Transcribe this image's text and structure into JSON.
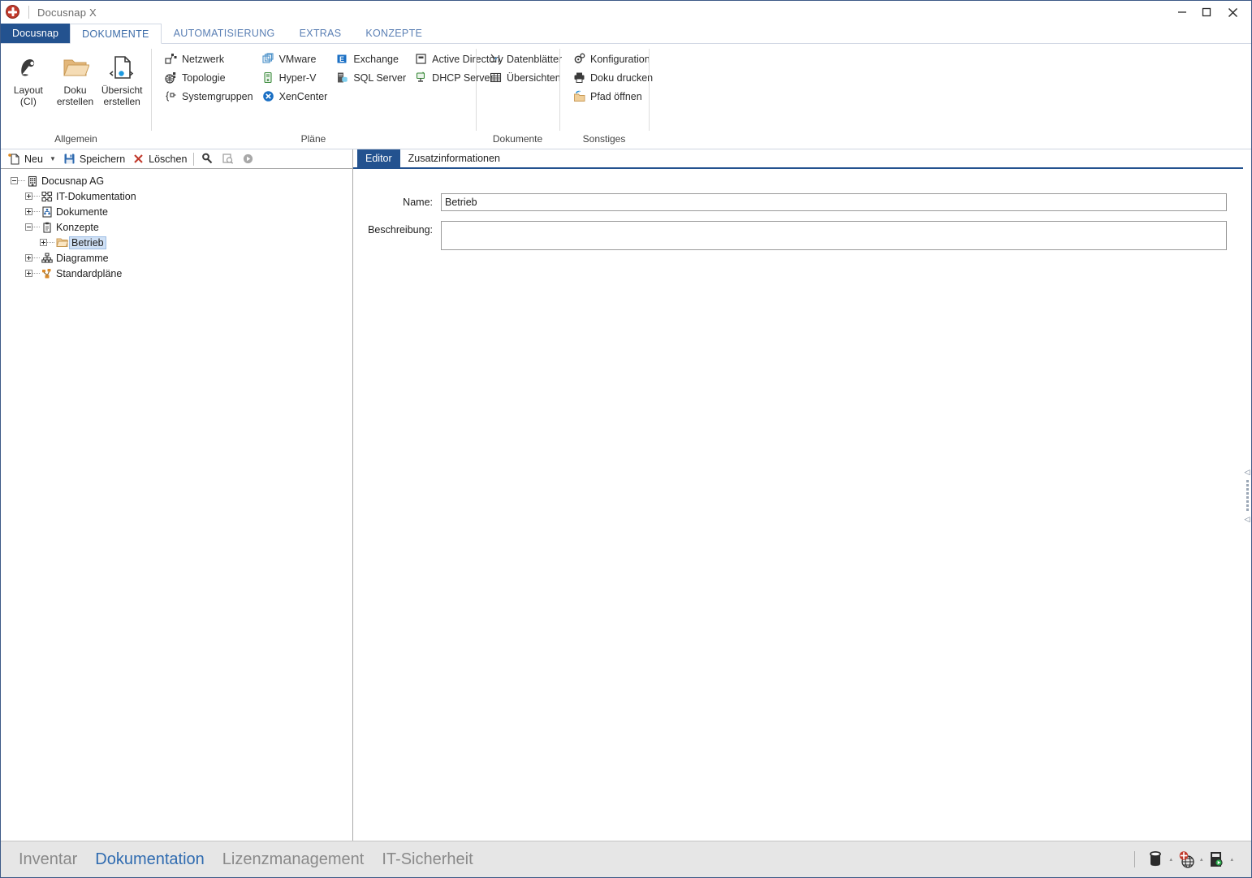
{
  "window": {
    "title": "Docusnap X",
    "logo_icon": "docusnap-logo-icon",
    "minimize_label": "–",
    "maximize_label": "□",
    "close_label": "✕"
  },
  "ribbon_tabs": [
    {
      "label": "Docusnap",
      "state": "brand"
    },
    {
      "label": "DOKUMENTE",
      "state": "active"
    },
    {
      "label": "AUTOMATISIERUNG",
      "state": "normal"
    },
    {
      "label": "EXTRAS",
      "state": "normal"
    },
    {
      "label": "KONZEPTE",
      "state": "normal"
    }
  ],
  "ribbon_groups": [
    {
      "name": "Allgemein",
      "label": "Allgemein",
      "big_buttons": [
        {
          "label_line1": "Layout",
          "label_line2": "(CI)",
          "icon": "layout-ci-icon"
        },
        {
          "label_line1": "Doku",
          "label_line2": "erstellen",
          "icon": "folder-open-icon"
        },
        {
          "label_line1": "Übersicht",
          "label_line2": "erstellen",
          "icon": "document-overview-icon"
        }
      ]
    },
    {
      "name": "Plaene",
      "label": "Pläne",
      "columns": [
        [
          {
            "label": "Netzwerk",
            "icon": "network-plan-icon"
          },
          {
            "label": "Topologie",
            "icon": "topology-icon"
          },
          {
            "label": "Systemgruppen",
            "icon": "system-groups-icon"
          }
        ],
        [
          {
            "label": "VMware",
            "icon": "vmware-icon"
          },
          {
            "label": "Hyper-V",
            "icon": "hyperv-icon"
          },
          {
            "label": "XenCenter",
            "icon": "xencenter-icon"
          }
        ],
        [
          {
            "label": "Exchange",
            "icon": "exchange-icon"
          },
          {
            "label": "SQL Server",
            "icon": "sql-server-icon"
          }
        ],
        [
          {
            "label": "Active Directory",
            "icon": "active-directory-icon"
          },
          {
            "label": "DHCP Server",
            "icon": "dhcp-server-icon"
          }
        ]
      ]
    },
    {
      "name": "Dokumente",
      "label": "Dokumente",
      "columns": [
        [
          {
            "label": "Datenblätter",
            "icon": "datasheet-icon"
          },
          {
            "label": "Übersichten",
            "icon": "grid-table-icon"
          }
        ]
      ]
    },
    {
      "name": "Sonstiges",
      "label": "Sonstiges",
      "columns": [
        [
          {
            "label": "Konfiguration",
            "icon": "gear-icon"
          },
          {
            "label": "Doku drucken",
            "icon": "printer-icon"
          },
          {
            "label": "Pfad öffnen",
            "icon": "open-path-icon"
          }
        ]
      ]
    }
  ],
  "left_toolbar": {
    "new_label": "Neu",
    "new_icon": "new-document-icon",
    "dropdown_icon": "chevron-down-icon",
    "save_label": "Speichern",
    "save_icon": "save-disk-icon",
    "delete_label": "Löschen",
    "delete_icon": "delete-x-icon",
    "search_icon": "search-key-icon",
    "preview_icon": "preview-zoom-icon",
    "run_icon": "run-play-icon"
  },
  "tree": [
    {
      "label": "Docusnap AG",
      "level": 0,
      "expander": "minus",
      "icon": "company-building-icon",
      "selected": false
    },
    {
      "label": "IT-Dokumentation",
      "level": 1,
      "expander": "plus",
      "icon": "it-documentation-icon",
      "selected": false
    },
    {
      "label": "Dokumente",
      "level": 1,
      "expander": "plus",
      "icon": "documents-icon",
      "selected": false
    },
    {
      "label": "Konzepte",
      "level": 1,
      "expander": "minus",
      "icon": "clipboard-icon",
      "selected": false
    },
    {
      "label": "Betrieb",
      "level": 2,
      "expander": "plus",
      "icon": "folder-icon",
      "selected": true
    },
    {
      "label": "Diagramme",
      "level": 1,
      "expander": "plus",
      "icon": "diagram-hierarchy-icon",
      "selected": false
    },
    {
      "label": "Standardpläne",
      "level": 1,
      "expander": "plus",
      "icon": "standard-plans-icon",
      "selected": false
    }
  ],
  "editor": {
    "tabs": [
      {
        "label": "Editor",
        "active": true
      },
      {
        "label": "Zusatzinformationen",
        "active": false
      }
    ],
    "name_label": "Name:",
    "name_value": "Betrieb",
    "name_placeholder": "",
    "description_label": "Beschreibung:",
    "description_value": "",
    "description_placeholder": ""
  },
  "right_splitter": {
    "collapse_top_icon": "triangle-left-icon",
    "collapse_bottom_icon": "triangle-left-icon",
    "grip_icon": "drag-grip-icon"
  },
  "statusbar": {
    "modules": [
      {
        "label": "Inventar",
        "active": false
      },
      {
        "label": "Dokumentation",
        "active": true
      },
      {
        "label": "Lizenzmanagement",
        "active": false
      },
      {
        "label": "IT-Sicherheit",
        "active": false
      }
    ],
    "icons": [
      {
        "name": "database-icon",
        "caret": "▴"
      },
      {
        "name": "docusnap-globe-icon",
        "caret": "▴"
      },
      {
        "name": "server-running-icon",
        "caret": "▴"
      }
    ]
  },
  "colors": {
    "brand_blue": "#23528f",
    "tab_text_blue": "#3c6ca8",
    "accent_link": "#2f6bb0",
    "selection_blue": "#cfe0f5",
    "statusbar_bg": "#e6e6e6"
  }
}
